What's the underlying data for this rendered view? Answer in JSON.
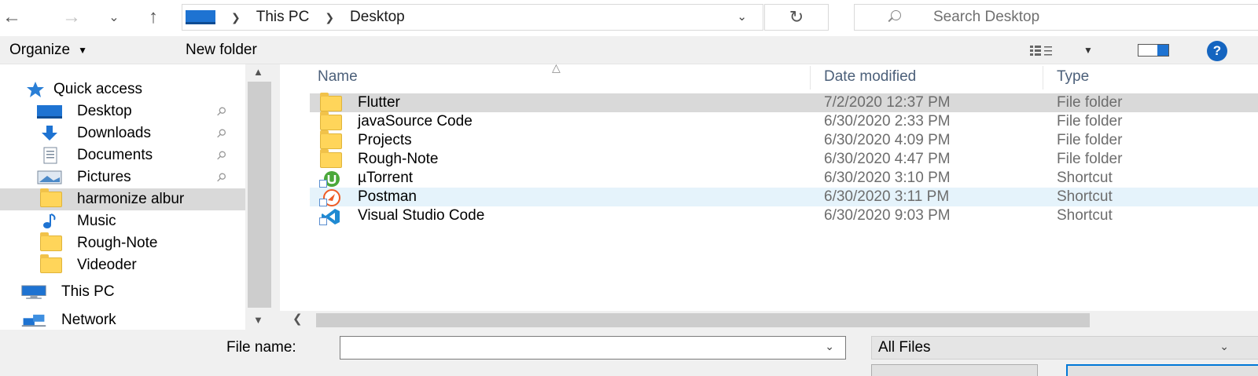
{
  "address": {
    "breadcrumbs": [
      "This PC",
      "Desktop"
    ],
    "search_placeholder": "Search Desktop"
  },
  "toolbar": {
    "organize_label": "Organize",
    "new_folder_label": "New folder",
    "help_label": "?"
  },
  "nav": {
    "quick_access_label": "Quick access",
    "items": [
      {
        "label": "Desktop",
        "icon": "desktop-icon",
        "pinned": true
      },
      {
        "label": "Downloads",
        "icon": "downloads-icon",
        "pinned": true
      },
      {
        "label": "Documents",
        "icon": "documents-icon",
        "pinned": true
      },
      {
        "label": "Pictures",
        "icon": "pictures-icon",
        "pinned": true
      },
      {
        "label": "harmonize albur",
        "icon": "folder-icon",
        "pinned": false,
        "selected": true
      },
      {
        "label": "Music",
        "icon": "music-icon",
        "pinned": false
      },
      {
        "label": "Rough-Note",
        "icon": "folder-icon",
        "pinned": false
      },
      {
        "label": "Videoder",
        "icon": "folder-icon",
        "pinned": false
      }
    ],
    "this_pc_label": "This PC",
    "network_label": "Network"
  },
  "columns": {
    "name": "Name",
    "date_modified": "Date modified",
    "type": "Type"
  },
  "files": [
    {
      "name": "Flutter",
      "date": "7/2/2020 12:37 PM",
      "type": "File folder",
      "icon": "folder-icon",
      "state": "hover"
    },
    {
      "name": "javaSource Code",
      "date": "6/30/2020 2:33 PM",
      "type": "File folder",
      "icon": "folder-icon"
    },
    {
      "name": "Projects",
      "date": "6/30/2020 4:09 PM",
      "type": "File folder",
      "icon": "folder-icon"
    },
    {
      "name": "Rough-Note",
      "date": "6/30/2020 4:47 PM",
      "type": "File folder",
      "icon": "folder-icon"
    },
    {
      "name": "µTorrent",
      "date": "6/30/2020 3:10 PM",
      "type": "Shortcut",
      "icon": "utorrent-icon"
    },
    {
      "name": "Postman",
      "date": "6/30/2020 3:11 PM",
      "type": "Shortcut",
      "icon": "postman-icon",
      "state": "focus"
    },
    {
      "name": "Visual Studio Code",
      "date": "6/30/2020 9:03 PM",
      "type": "Shortcut",
      "icon": "vscode-icon"
    }
  ],
  "bottom": {
    "file_name_label": "File name:",
    "file_name_value": "",
    "filter_value": "All Files"
  },
  "colors": {
    "accent": "#0078d7",
    "folder": "#ffd55a",
    "selection": "#d9d9d9",
    "focus_row": "#e5f3fb",
    "header_text": "#4c607a"
  }
}
